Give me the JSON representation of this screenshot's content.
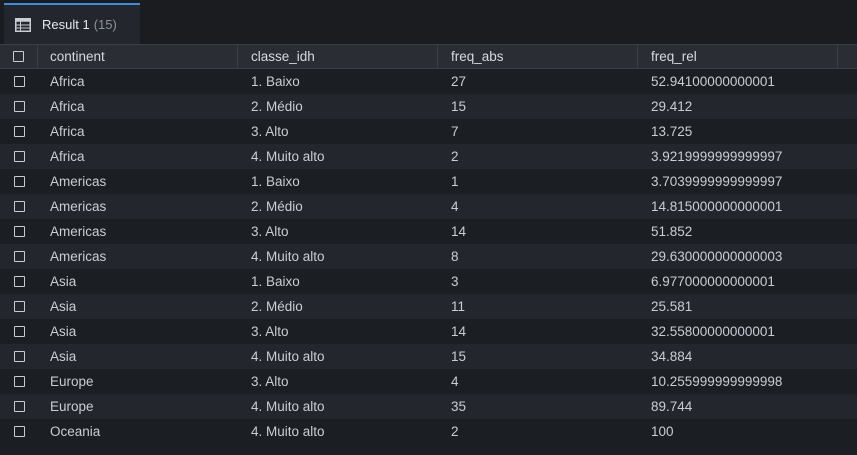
{
  "tab": {
    "label": "Result 1",
    "count": "(15)"
  },
  "columns": [
    "continent",
    "classe_idh",
    "freq_abs",
    "freq_rel"
  ],
  "rows": [
    [
      "Africa",
      "1. Baixo",
      "27",
      "52.94100000000001"
    ],
    [
      "Africa",
      "2. Médio",
      "15",
      "29.412"
    ],
    [
      "Africa",
      "3. Alto",
      "7",
      "13.725"
    ],
    [
      "Africa",
      "4. Muito alto",
      "2",
      "3.9219999999999997"
    ],
    [
      "Americas",
      "1. Baixo",
      "1",
      "3.7039999999999997"
    ],
    [
      "Americas",
      "2. Médio",
      "4",
      "14.815000000000001"
    ],
    [
      "Americas",
      "3. Alto",
      "14",
      "51.852"
    ],
    [
      "Americas",
      "4. Muito alto",
      "8",
      "29.630000000000003"
    ],
    [
      "Asia",
      "1. Baixo",
      "3",
      "6.977000000000001"
    ],
    [
      "Asia",
      "2. Médio",
      "11",
      "25.581"
    ],
    [
      "Asia",
      "3. Alto",
      "14",
      "32.55800000000001"
    ],
    [
      "Asia",
      "4. Muito alto",
      "15",
      "34.884"
    ],
    [
      "Europe",
      "3. Alto",
      "4",
      "10.255999999999998"
    ],
    [
      "Europe",
      "4. Muito alto",
      "35",
      "89.744"
    ],
    [
      "Oceania",
      "4. Muito alto",
      "2",
      "100"
    ]
  ],
  "colors": {
    "accent": "#3b8fd8",
    "row_alt": "#23272d",
    "row": "#1b1e23",
    "header": "#2a2e34"
  },
  "icons": {
    "tab": "table-icon",
    "row_select": "checkbox-icon"
  }
}
